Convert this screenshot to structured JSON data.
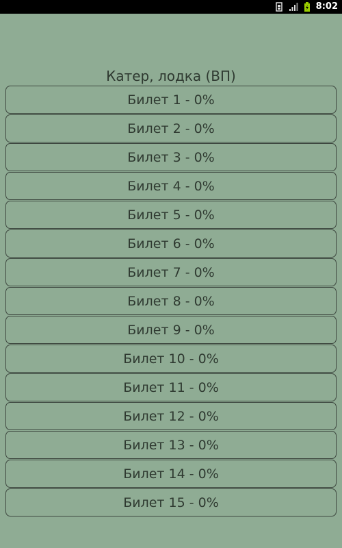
{
  "status_bar": {
    "time": "8:02",
    "icons": [
      "sim-card-icon",
      "signal-icon",
      "battery-charging-icon"
    ]
  },
  "screen": {
    "title": "Катер, лодка (ВП)"
  },
  "tickets": [
    {
      "label": "Билет 1 - 0%"
    },
    {
      "label": "Билет 2 - 0%"
    },
    {
      "label": "Билет 3 - 0%"
    },
    {
      "label": "Билет 4 - 0%"
    },
    {
      "label": "Билет 5 - 0%"
    },
    {
      "label": "Билет 6 - 0%"
    },
    {
      "label": "Билет 7 - 0%"
    },
    {
      "label": "Билет 8 - 0%"
    },
    {
      "label": "Билет 9 - 0%"
    },
    {
      "label": "Билет 10 - 0%"
    },
    {
      "label": "Билет 11 - 0%"
    },
    {
      "label": "Билет 12 - 0%"
    },
    {
      "label": "Билет 13 - 0%"
    },
    {
      "label": "Билет 14 - 0%"
    },
    {
      "label": "Билет 15 - 0%"
    }
  ],
  "colors": {
    "background": "#8fac94",
    "text": "#2f3a31",
    "border": "#3d473f",
    "status_bar": "#000000",
    "battery": "#99cc00"
  }
}
